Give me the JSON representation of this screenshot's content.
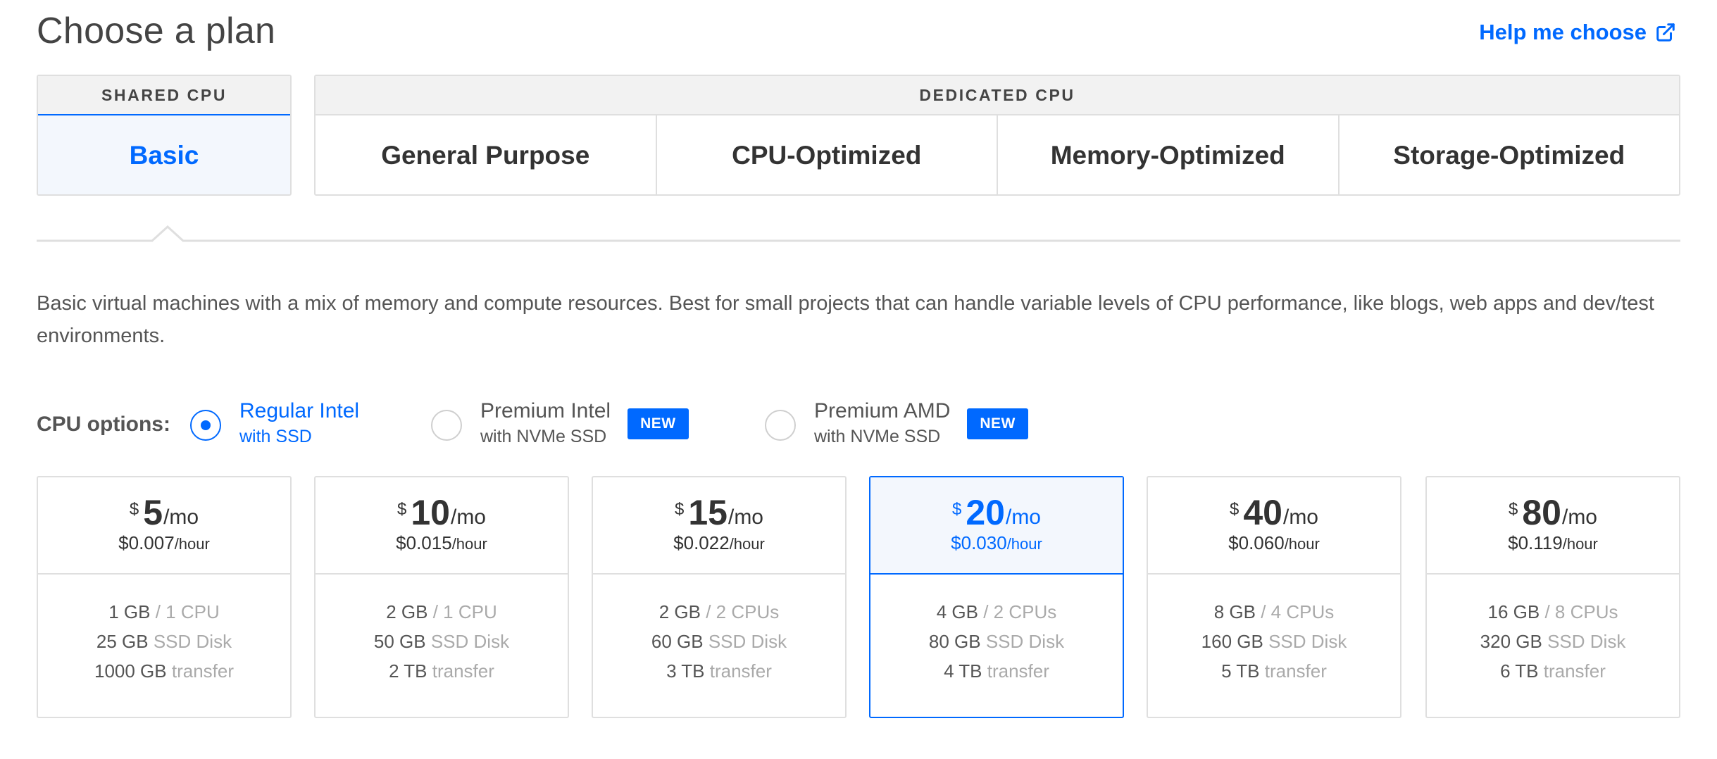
{
  "header": {
    "title": "Choose a plan",
    "help_label": "Help me choose"
  },
  "categories": {
    "shared": {
      "header": "SHARED CPU",
      "tabs": [
        {
          "label": "Basic",
          "active": true
        }
      ]
    },
    "dedicated": {
      "header": "DEDICATED CPU",
      "tabs": [
        {
          "label": "General Purpose"
        },
        {
          "label": "CPU-Optimized"
        },
        {
          "label": "Memory-Optimized"
        },
        {
          "label": "Storage-Optimized"
        }
      ]
    }
  },
  "description": "Basic virtual machines with a mix of memory and compute resources. Best for small projects that can handle variable levels of CPU performance, like blogs, web apps and dev/test environments.",
  "cpu_options": {
    "label": "CPU options:",
    "options": [
      {
        "main": "Regular Intel",
        "sub": "with SSD",
        "selected": true,
        "badge": ""
      },
      {
        "main": "Premium Intel",
        "sub": "with NVMe SSD",
        "selected": false,
        "badge": "NEW"
      },
      {
        "main": "Premium AMD",
        "sub": "with NVMe SSD",
        "selected": false,
        "badge": "NEW"
      }
    ]
  },
  "plans": [
    {
      "currency": "$",
      "amount": "5",
      "per": "/mo",
      "hourly": "$0.007",
      "hourly_unit": "/hour",
      "memory": "1 GB",
      "cpu": "/ 1 CPU",
      "disk": "25 GB",
      "disk_type": "SSD Disk",
      "transfer": "1000 GB",
      "transfer_label": "transfer",
      "selected": false
    },
    {
      "currency": "$",
      "amount": "10",
      "per": "/mo",
      "hourly": "$0.015",
      "hourly_unit": "/hour",
      "memory": "2 GB",
      "cpu": "/ 1 CPU",
      "disk": "50 GB",
      "disk_type": "SSD Disk",
      "transfer": "2 TB",
      "transfer_label": "transfer",
      "selected": false
    },
    {
      "currency": "$",
      "amount": "15",
      "per": "/mo",
      "hourly": "$0.022",
      "hourly_unit": "/hour",
      "memory": "2 GB",
      "cpu": "/ 2 CPUs",
      "disk": "60 GB",
      "disk_type": "SSD Disk",
      "transfer": "3 TB",
      "transfer_label": "transfer",
      "selected": false
    },
    {
      "currency": "$",
      "amount": "20",
      "per": "/mo",
      "hourly": "$0.030",
      "hourly_unit": "/hour",
      "memory": "4 GB",
      "cpu": "/ 2 CPUs",
      "disk": "80 GB",
      "disk_type": "SSD Disk",
      "transfer": "4 TB",
      "transfer_label": "transfer",
      "selected": true
    },
    {
      "currency": "$",
      "amount": "40",
      "per": "/mo",
      "hourly": "$0.060",
      "hourly_unit": "/hour",
      "memory": "8 GB",
      "cpu": "/ 4 CPUs",
      "disk": "160 GB",
      "disk_type": "SSD Disk",
      "transfer": "5 TB",
      "transfer_label": "transfer",
      "selected": false
    },
    {
      "currency": "$",
      "amount": "80",
      "per": "/mo",
      "hourly": "$0.119",
      "hourly_unit": "/hour",
      "memory": "16 GB",
      "cpu": "/ 8 CPUs",
      "disk": "320 GB",
      "disk_type": "SSD Disk",
      "transfer": "6 TB",
      "transfer_label": "transfer",
      "selected": false
    }
  ],
  "colors": {
    "accent": "#0069ff",
    "selected_bg": "#f3f7fd",
    "border": "#dfdfdf",
    "header_bg": "#f2f2f2",
    "muted_text": "#aaaaaa"
  },
  "icons": {
    "help": "external-link-icon"
  }
}
